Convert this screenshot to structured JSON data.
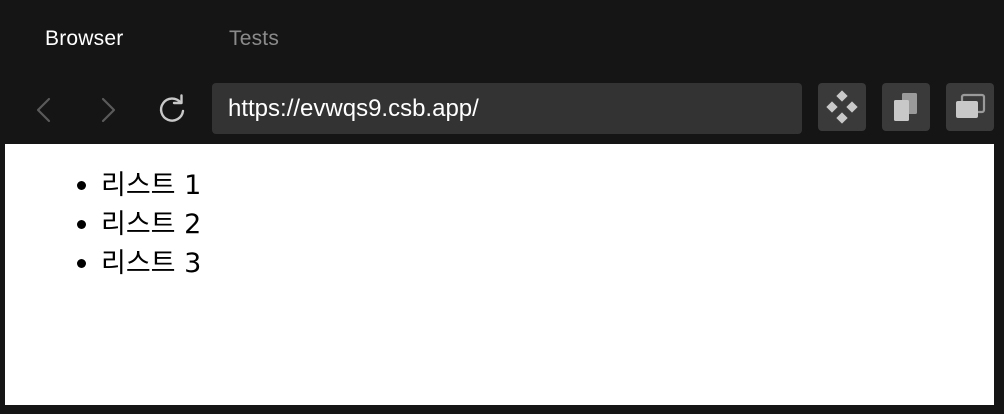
{
  "tabs": {
    "browser": "Browser",
    "tests": "Tests"
  },
  "toolbar": {
    "back_icon": "chevron-left",
    "forward_icon": "chevron-right",
    "reload_icon": "reload",
    "url": "https://evwqs9.csb.app/",
    "devtools_icon": "diamond-grid",
    "copy_icon": "copy",
    "window_icon": "open-window"
  },
  "page": {
    "items": [
      "리스트 1",
      "리스트 2",
      "리스트 3"
    ]
  },
  "colors": {
    "chrome_bg": "#151515",
    "url_bg": "#333333",
    "button_bg": "#3a3a3a",
    "active_tab": "#ffffff",
    "inactive_tab": "#8a8a8a",
    "disabled_icon": "#5a5a5a",
    "icon": "#c8c8c8"
  }
}
